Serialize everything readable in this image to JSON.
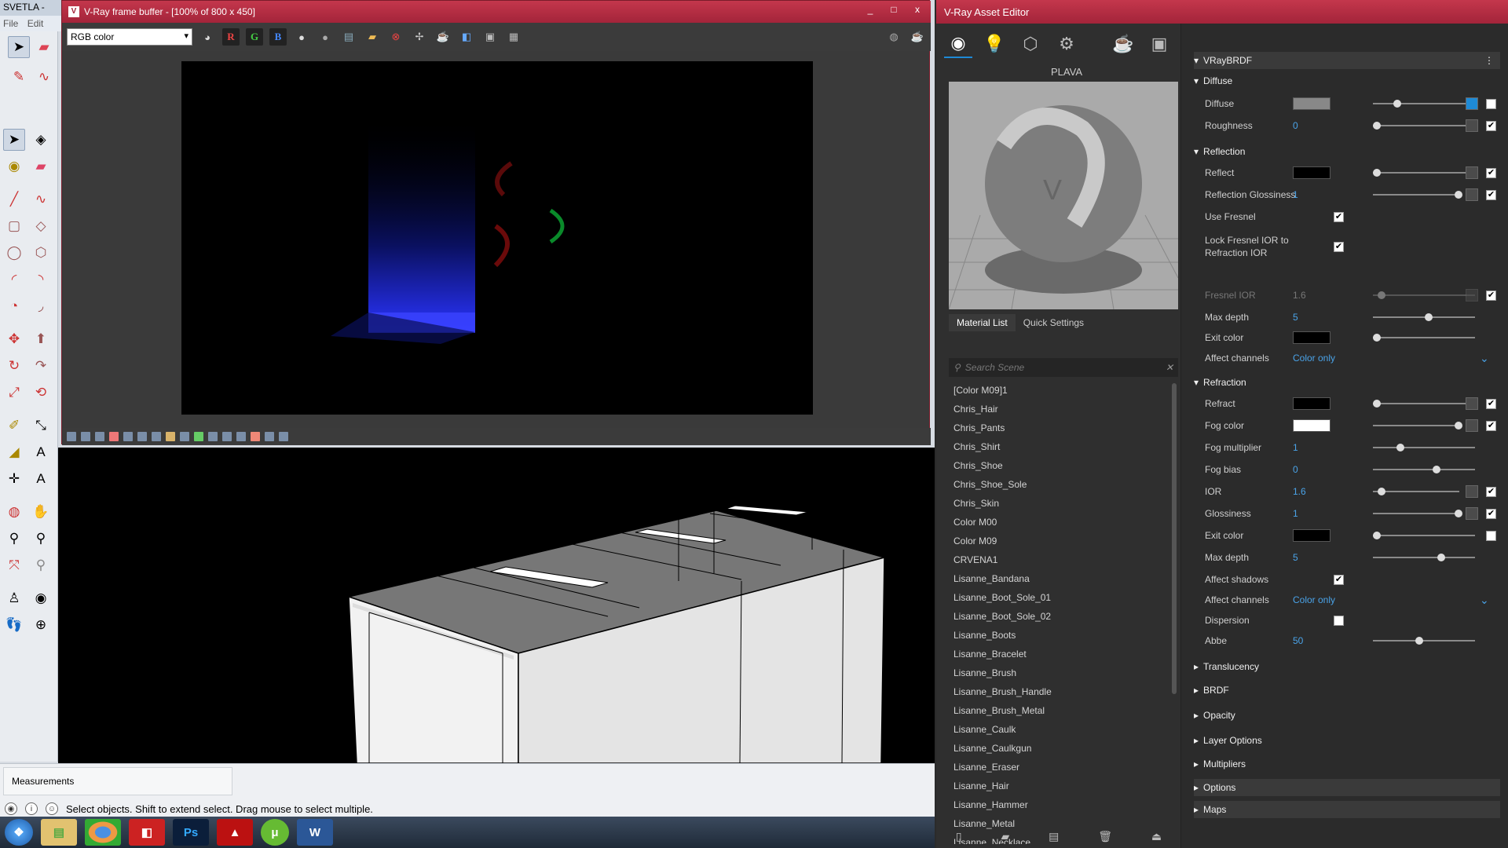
{
  "sketchup": {
    "title": "SVETLA -",
    "menu": [
      "File",
      "Edit"
    ],
    "measurements_label": "Measurements",
    "status_text": "Select objects. Shift to extend select. Drag mouse to select multiple."
  },
  "frame_buffer": {
    "title": "V-Ray frame buffer - [100% of 800 x 450]",
    "channel": "RGB color",
    "channel_buttons": [
      "R",
      "G",
      "B"
    ],
    "window_buttons": [
      "_",
      "□",
      "x"
    ]
  },
  "asset_editor": {
    "title": "V-Ray Asset Editor",
    "material_name": "PLAVA",
    "tabs": [
      "Material List",
      "Quick Settings"
    ],
    "search_placeholder": "Search Scene",
    "materials": [
      "[Color M09]1",
      "Chris_Hair",
      "Chris_Pants",
      "Chris_Shirt",
      "Chris_Shoe",
      "Chris_Shoe_Sole",
      "Chris_Skin",
      "Color M00",
      "Color M09",
      "CRVENA1",
      "Lisanne_Bandana",
      "Lisanne_Boot_Sole_01",
      "Lisanne_Boot_Sole_02",
      "Lisanne_Boots",
      "Lisanne_Bracelet",
      "Lisanne_Brush",
      "Lisanne_Brush_Handle",
      "Lisanne_Brush_Metal",
      "Lisanne_Caulk",
      "Lisanne_Caulkgun",
      "Lisanne_Eraser",
      "Lisanne_Hair",
      "Lisanne_Hammer",
      "Lisanne_Metal",
      "Lisanne_Necklace"
    ],
    "brdf_title": "VRayBRDF",
    "diffuse": {
      "section": "Diffuse",
      "diffuse_label": "Diffuse",
      "roughness_label": "Roughness",
      "roughness_value": "0"
    },
    "reflection": {
      "section": "Reflection",
      "reflect_label": "Reflect",
      "gloss_label": "Reflection Glossiness",
      "gloss_value": "1",
      "fresnel_label": "Use Fresnel",
      "lock_label": "Lock Fresnel IOR to Refraction IOR",
      "fresnel_ior_label": "Fresnel IOR",
      "fresnel_ior_value": "1.6",
      "maxdepth_label": "Max depth",
      "maxdepth_value": "5",
      "exit_label": "Exit color",
      "affect_label": "Affect channels",
      "affect_value": "Color only"
    },
    "refraction": {
      "section": "Refraction",
      "refract_label": "Refract",
      "fog_label": "Fog color",
      "fogmult_label": "Fog multiplier",
      "fogmult_value": "1",
      "fogbias_label": "Fog bias",
      "fogbias_value": "0",
      "ior_label": "IOR",
      "ior_value": "1.6",
      "gloss_label": "Glossiness",
      "gloss_value": "1",
      "exit_label": "Exit color",
      "maxdepth_label": "Max depth",
      "maxdepth_value": "5",
      "shadows_label": "Affect shadows",
      "affect_label": "Affect channels",
      "affect_value": "Color only",
      "dispersion_label": "Dispersion",
      "abbe_label": "Abbe",
      "abbe_value": "50"
    },
    "collapsed_sections": [
      "Translucency",
      "BRDF",
      "Opacity",
      "Layer Options",
      "Multipliers",
      "Options",
      "Maps"
    ]
  },
  "taskbar": {
    "apps": [
      "start-orb",
      "explorer",
      "chrome",
      "sketchup",
      "photoshop",
      "acrobat",
      "utorrent",
      "word"
    ],
    "ps_label": "Ps",
    "word_label": "W"
  },
  "colors": {
    "vray_title": "#b22d42",
    "accent_blue": "#4aa3e8"
  }
}
